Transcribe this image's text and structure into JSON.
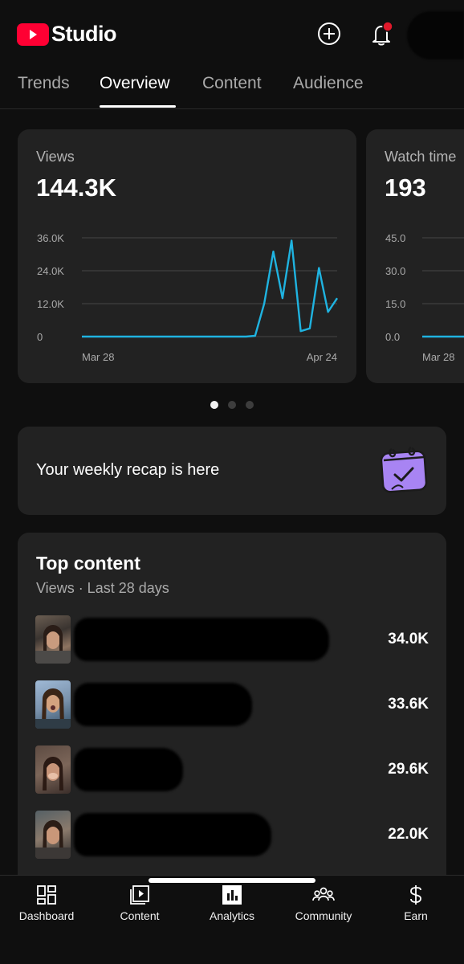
{
  "header": {
    "logo_text": "Studio",
    "brand_color": "#ff0033",
    "icons": [
      "create-icon",
      "bell-icon"
    ],
    "notification_dot_color": "#e0192b"
  },
  "tabs": [
    {
      "label": "Trends"
    },
    {
      "label": "Overview",
      "active": true
    },
    {
      "label": "Content"
    },
    {
      "label": "Audience"
    }
  ],
  "cards": {
    "views": {
      "label": "Views",
      "value": "144.3K"
    },
    "watch_time": {
      "label": "Watch time",
      "value": "193"
    }
  },
  "chart_data": [
    {
      "type": "line",
      "title": "Views",
      "y_ticks": [
        "36.0K",
        "24.0K",
        "12.0K",
        "0"
      ],
      "x_ticks": [
        "Mar 28",
        "Apr 24"
      ],
      "ylim": [
        0,
        36000
      ],
      "grid": true,
      "line_color": "#1fb3e0",
      "x": [
        "Mar 28",
        "Mar 29",
        "Mar 30",
        "Mar 31",
        "Apr 1",
        "Apr 2",
        "Apr 3",
        "Apr 4",
        "Apr 5",
        "Apr 6",
        "Apr 7",
        "Apr 8",
        "Apr 9",
        "Apr 10",
        "Apr 11",
        "Apr 12",
        "Apr 13",
        "Apr 14",
        "Apr 15",
        "Apr 16",
        "Apr 17",
        "Apr 18",
        "Apr 19",
        "Apr 20",
        "Apr 21",
        "Apr 22",
        "Apr 23",
        "Apr 24"
      ],
      "values": [
        0,
        0,
        0,
        0,
        0,
        0,
        0,
        0,
        0,
        0,
        0,
        0,
        0,
        0,
        0,
        0,
        0,
        0,
        0,
        300,
        12000,
        31000,
        14000,
        35000,
        2000,
        3000,
        25000,
        9000,
        14000
      ]
    },
    {
      "type": "line",
      "title": "Watch time",
      "y_ticks": [
        "45.0",
        "30.0",
        "15.0",
        "0.0"
      ],
      "x_ticks": [
        "Mar 28"
      ],
      "ylim": [
        0,
        45
      ],
      "grid": true,
      "line_color": "#1fb3e0",
      "values": [
        0,
        0,
        0,
        0
      ]
    }
  ],
  "carousel": {
    "count": 3,
    "active": 0
  },
  "recap": {
    "text": "Your weekly recap is here",
    "icon": "calendar-check-icon",
    "icon_color": "#a884f3"
  },
  "top_content": {
    "title": "Top content",
    "subtitle": "Views · Last 28 days",
    "items": [
      {
        "value": "34.0K"
      },
      {
        "value": "33.6K"
      },
      {
        "value": "29.6K"
      },
      {
        "value": "22.0K"
      }
    ]
  },
  "bottom_nav": [
    {
      "label": "Dashboard",
      "icon": "dashboard-icon"
    },
    {
      "label": "Content",
      "icon": "content-icon"
    },
    {
      "label": "Analytics",
      "icon": "analytics-icon",
      "active": true
    },
    {
      "label": "Community",
      "icon": "community-icon"
    },
    {
      "label": "Earn",
      "icon": "earn-icon"
    }
  ]
}
